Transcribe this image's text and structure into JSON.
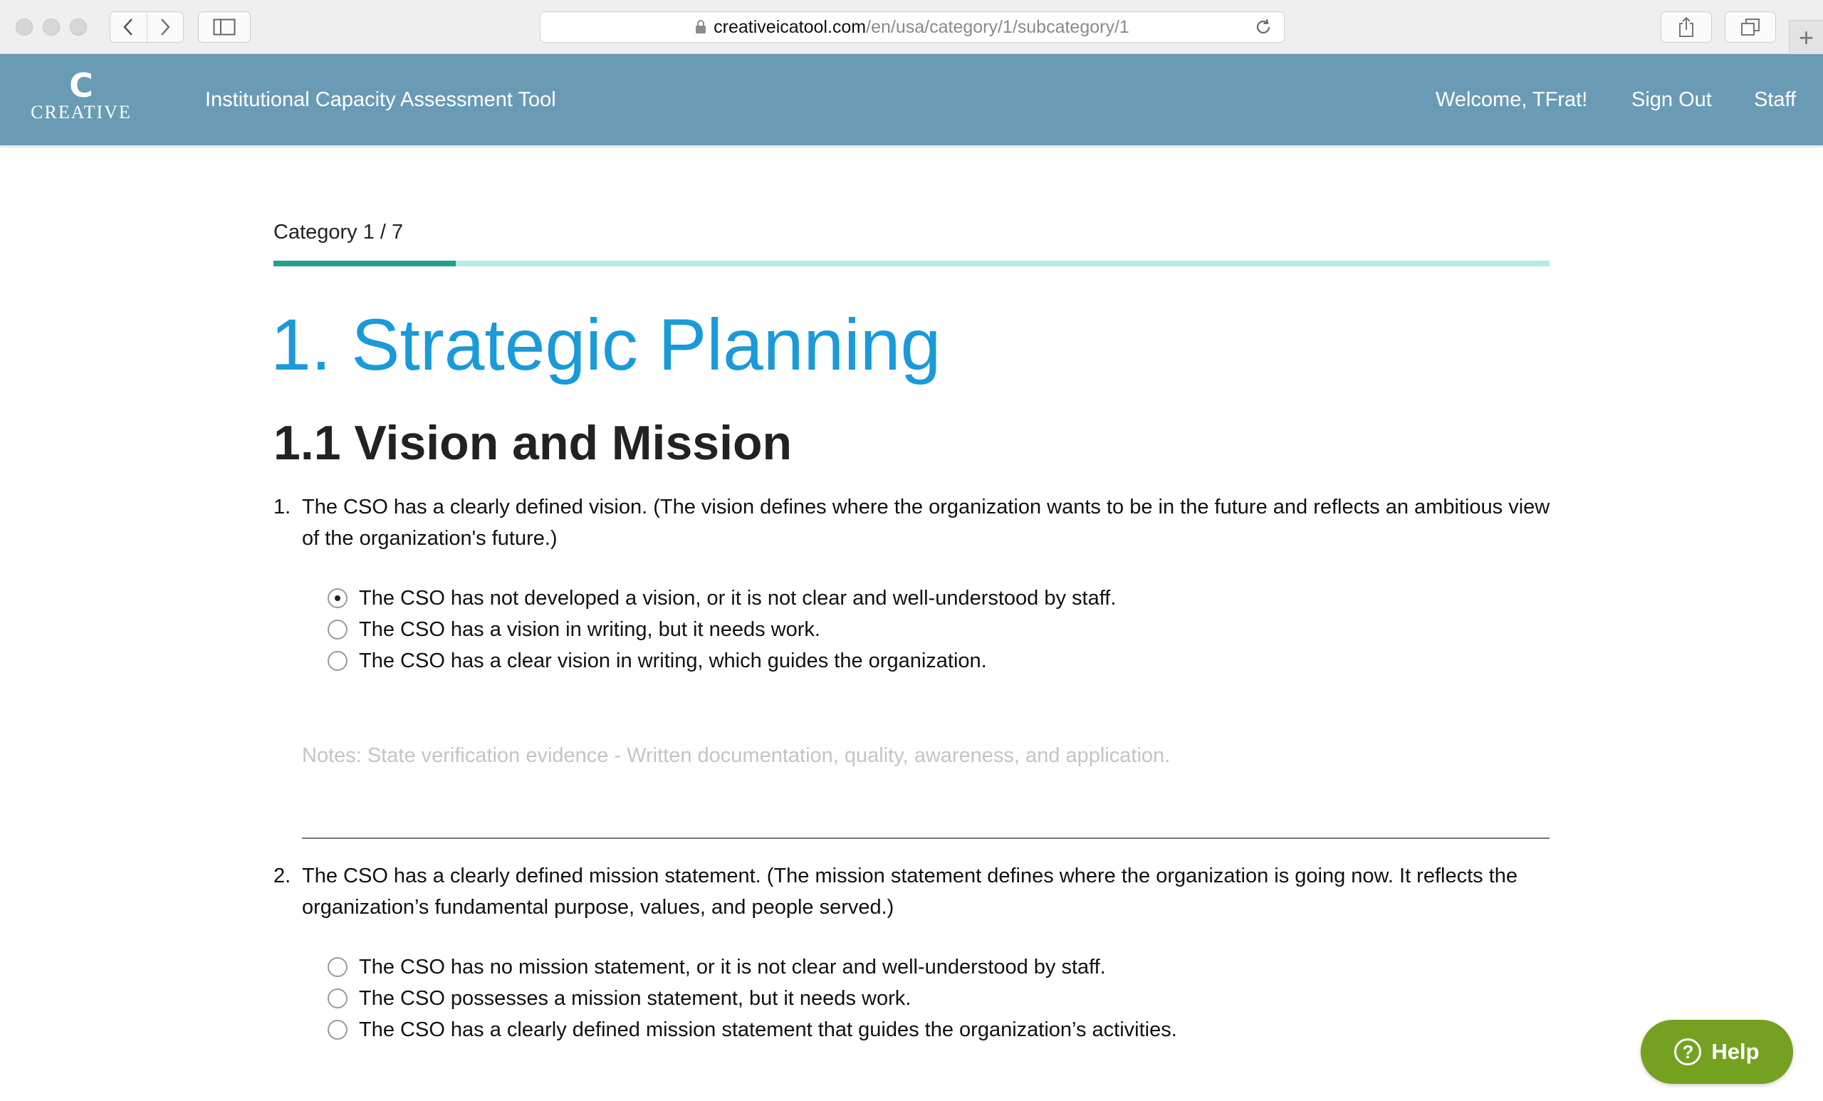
{
  "browser": {
    "url_domain": "creativeicatool.com",
    "url_path": "/en/usa/category/1/subcategory/1",
    "new_tab_label": "+"
  },
  "header": {
    "logo_mark": "C",
    "logo_text": "CREATIVE",
    "app_title": "Institutional Capacity Assessment Tool",
    "welcome": "Welcome, TFrat!",
    "sign_out": "Sign Out",
    "staff": "Staff",
    "background_color": "#6a9bb5"
  },
  "progress": {
    "label": "Category 1 / 7",
    "current": 1,
    "total": 7,
    "fill_color": "#22a08a",
    "track_color": "#b5ebe6"
  },
  "category_title": "1. Strategic Planning",
  "subcategory_title": "1.1 Vision and Mission",
  "questions": [
    {
      "number": "1.",
      "text": "The CSO has a clearly defined vision. (The vision defines where the organization wants to be in the future and reflects an ambitious view of the organization's future.)",
      "options": [
        "The CSO has not developed a vision, or it is not clear and well-understood by staff.",
        "The CSO has a vision in writing, but it needs work.",
        "The CSO has a clear vision in writing, which guides the organization."
      ],
      "selected_index": 0,
      "notes_placeholder": "Notes: State verification evidence - Written documentation, quality, awareness, and application."
    },
    {
      "number": "2.",
      "text": "The CSO has a clearly defined mission statement. (The mission statement defines where the organization is going now. It reflects the organization’s fundamental purpose, values, and people served.)",
      "options": [
        "The CSO has no mission statement, or it is not clear and well-understood by staff.",
        "The CSO possesses a mission statement, but it needs work.",
        "The CSO has a clearly defined mission statement that guides the organization’s activities."
      ],
      "selected_index": null
    }
  ],
  "help_button": {
    "icon": "?",
    "label": "Help",
    "color": "#75a120"
  },
  "title_color": "#1a9ad9"
}
